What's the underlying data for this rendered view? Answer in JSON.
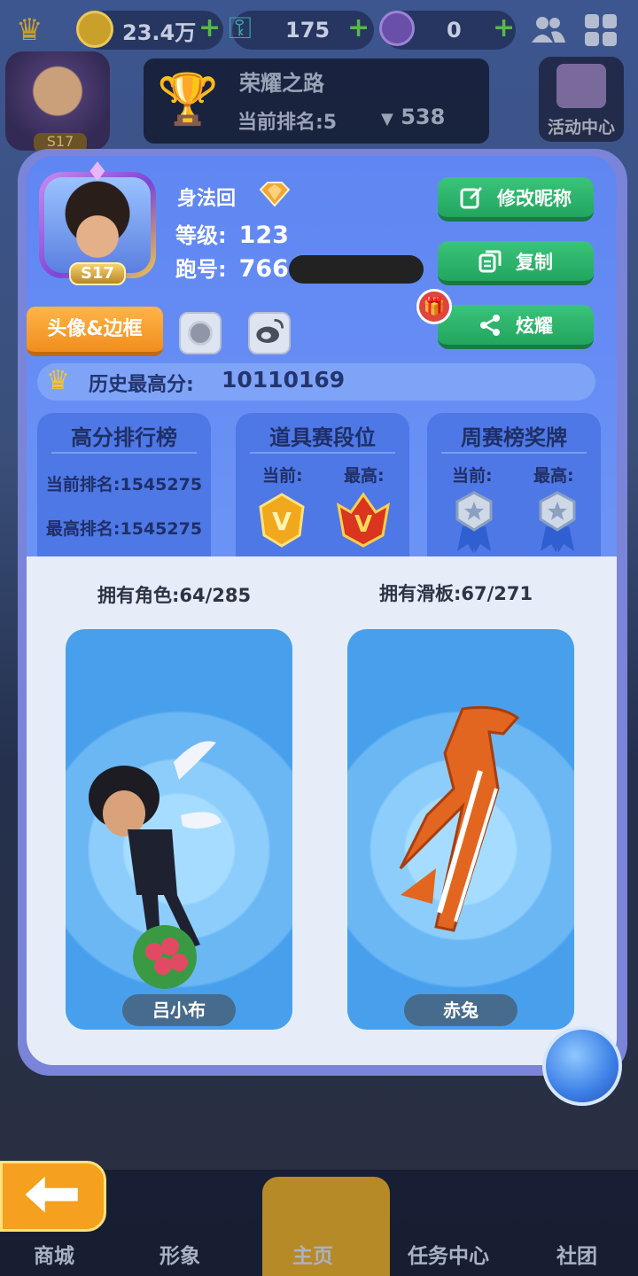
{
  "topbar": {
    "coins": "23.4万",
    "keys": "175",
    "gems": "0"
  },
  "honor": {
    "title": "荣耀之路",
    "rank": "当前排名:5",
    "cups": "538"
  },
  "activity_label": "活动中心",
  "bg_level": "S17",
  "profile": {
    "nickname": "身法回",
    "level_label": "等级:",
    "level_value": "123",
    "id_label": "跑号:",
    "id_value": "766",
    "avatar_level": "S17"
  },
  "buttons": {
    "rename": "修改昵称",
    "copy": "复制",
    "share": "炫耀",
    "avatar_frame": "头像&边框"
  },
  "best_score": {
    "label": "历史最高分:",
    "value": "10110169"
  },
  "stats": {
    "leaderboard": {
      "title": "高分排行榜",
      "current": "当前排名:1545275",
      "best": "最高排名:1545275"
    },
    "item_tier": {
      "title": "道具赛段位",
      "current_label": "当前:",
      "best_label": "最高:"
    },
    "weekly_medal": {
      "title": "周赛榜奖牌",
      "current_label": "当前:",
      "best_label": "最高:"
    }
  },
  "collection": {
    "roles_owned": "拥有角色:64/285",
    "boards_owned": "拥有滑板:67/271",
    "role_name": "吕小布",
    "board_name": "赤兔"
  },
  "nav": {
    "items": [
      "商城",
      "形象",
      "主页",
      "任务中心",
      "社团"
    ]
  },
  "colors": {
    "modal_bg": "#6b92f5",
    "green_button": "#22a55f",
    "orange_button": "#f08e1e",
    "nav_home": "#b78a28"
  }
}
